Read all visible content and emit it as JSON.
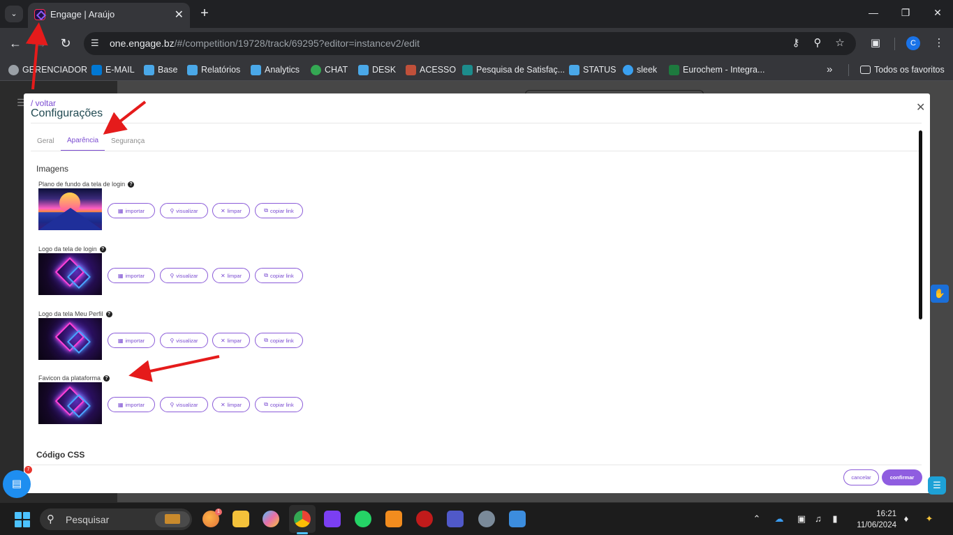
{
  "browser": {
    "tab_title": "Engage | Araújo",
    "url_domain": "one.engage.bz",
    "url_path": "/#/competition/19728/track/69295?editor=instancev2/edit",
    "profile_initial": "C",
    "bookmarks": [
      {
        "label": "GERENCIADOR",
        "color": "#9aa0a6"
      },
      {
        "label": "E-MAIL",
        "color": "#0078d4"
      },
      {
        "label": "Base",
        "color": "#4aa8e8"
      },
      {
        "label": "Relatórios",
        "color": "#4aa8e8"
      },
      {
        "label": "Analytics",
        "color": "#4aa8e8"
      },
      {
        "label": "CHAT",
        "color": "#34a853"
      },
      {
        "label": "DESK",
        "color": "#4aa8e8"
      },
      {
        "label": "ACESSO",
        "color": "#c0503a"
      },
      {
        "label": "Pesquisa de Satisfaç...",
        "color": "#1c8c8c"
      },
      {
        "label": "STATUS",
        "color": "#4aa8e8"
      },
      {
        "label": "sleek",
        "color": "#3aa0f0"
      },
      {
        "label": "Eurochem - Integra...",
        "color": "#1d7a3e"
      }
    ],
    "all_bookmarks_label": "Todos os favoritos"
  },
  "modal": {
    "back_label": "/ voltar",
    "title": "Configurações",
    "tabs": [
      "Geral",
      "Aparência",
      "Segurança"
    ],
    "active_tab": "Aparência",
    "section_images": "Imagens",
    "items": [
      {
        "label": "Plano de fundo da tela de login",
        "image": "sunset"
      },
      {
        "label": "Logo da tela de login",
        "image": "neon"
      },
      {
        "label": "Logo da tela Meu Perfil",
        "image": "neon"
      },
      {
        "label": "Favicon da plataforma",
        "image": "neon"
      }
    ],
    "buttons": {
      "import": "importar",
      "view": "visualizar",
      "clear": "limpar",
      "copy": "copiar link"
    },
    "section_css": "Código CSS",
    "cancel": "cancelar",
    "confirm": "confirmar"
  },
  "widgets": {
    "chat_badge": "7"
  },
  "taskbar": {
    "search_placeholder": "Pesquisar",
    "weather_badge": "1",
    "time": "16:21",
    "date": "11/06/2024"
  },
  "colors": {
    "accent": "#7a4bd1",
    "title": "#214a52",
    "annotation_arrow": "#e51b1b"
  }
}
